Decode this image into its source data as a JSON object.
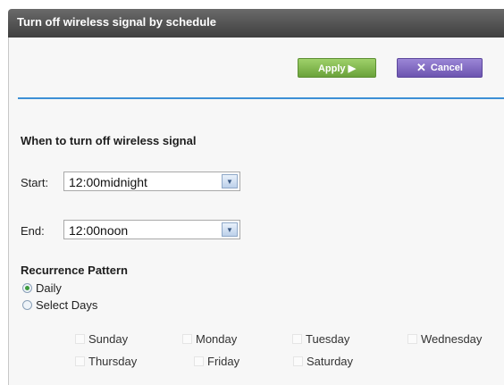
{
  "window": {
    "title": "Turn off wireless signal by schedule"
  },
  "toolbar": {
    "apply_label": "Apply ▶",
    "cancel_label": "Cancel"
  },
  "schedule": {
    "heading": "When to turn off wireless signal",
    "start_label": "Start:",
    "start_value": "12:00midnight",
    "end_label": "End:",
    "end_value": "12:00noon"
  },
  "recurrence": {
    "heading": "Recurrence Pattern",
    "daily_label": "Daily",
    "select_days_label": "Select Days",
    "days": [
      "Sunday",
      "Monday",
      "Tuesday",
      "Wednesday",
      "Thursday",
      "Friday",
      "Saturday"
    ]
  },
  "colors": {
    "accent_line": "#3d8fd6",
    "apply": "#7fb84a",
    "cancel": "#7a62c0",
    "titlebar": "#4a4a4a"
  }
}
